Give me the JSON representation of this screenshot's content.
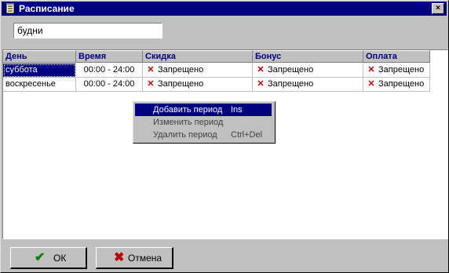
{
  "window": {
    "title": "Расписание",
    "close_label": "×"
  },
  "schedule_name": "будни",
  "table": {
    "columns": [
      "День",
      "Время",
      "Скидка",
      "Бонус",
      "Оплата"
    ],
    "rows": [
      {
        "day": "суббота",
        "time": "00:00 - 24:00",
        "discount": "Запрещено",
        "bonus": "Запрещено",
        "payment": "Запрещено"
      },
      {
        "day": "воскресенье",
        "time": "00:00 - 24:00",
        "discount": "Запрещено",
        "bonus": "Запрещено",
        "payment": "Запрещено"
      }
    ]
  },
  "context_menu": {
    "items": [
      {
        "label": "Добавить период",
        "shortcut": "Ins"
      },
      {
        "label": "Изменить период",
        "shortcut": ""
      },
      {
        "label": "Удалить период",
        "shortcut": "Ctrl+Del"
      }
    ]
  },
  "buttons": {
    "ok": "ОК",
    "cancel": "Отмена"
  },
  "icons": {
    "window": "notepad-icon",
    "forbidden": "x-icon",
    "ok": "check-icon",
    "cancel": "x-icon"
  },
  "colors": {
    "titlebar": "#000080",
    "selection": "#000080",
    "forbidden_mark": "#c00000",
    "ok_mark": "#008000"
  }
}
